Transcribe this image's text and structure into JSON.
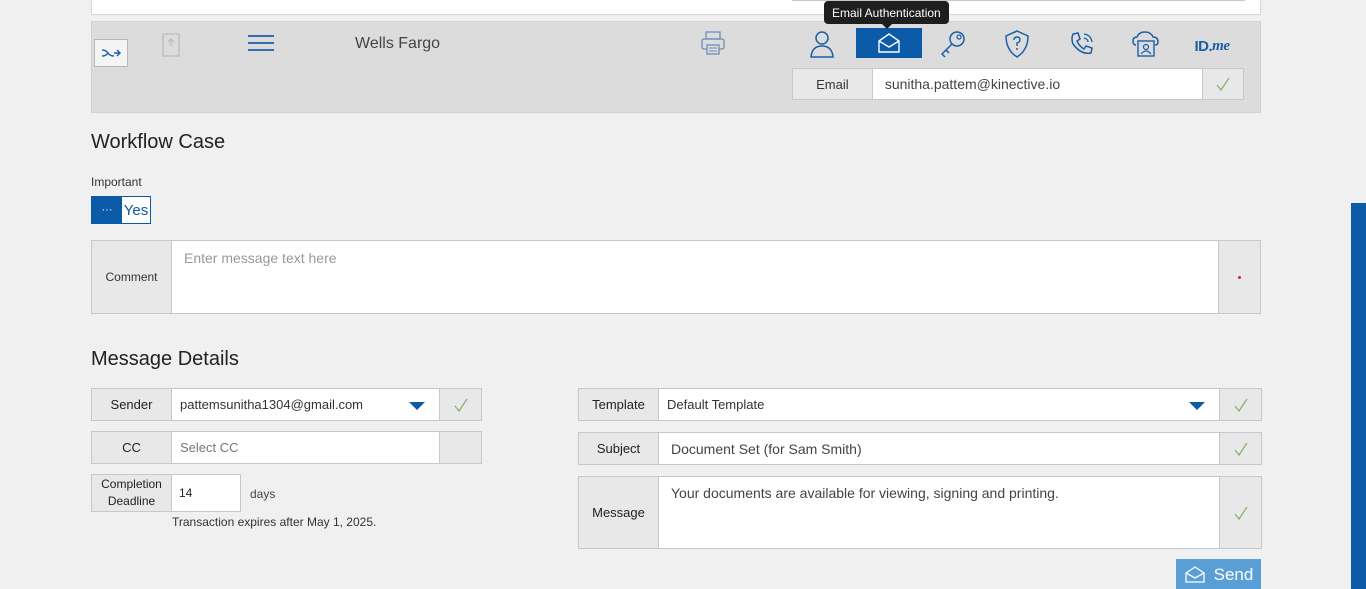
{
  "toolbar": {
    "org_name": "Wells Fargo",
    "tooltip": "Email Authentication",
    "idme_label_main": "ID.",
    "idme_label_suffix": "me",
    "email_label": "Email",
    "email_value": "sunitha.pattem@kinective.io",
    "active_color": "#0b5ba8"
  },
  "workflow": {
    "title": "Workflow Case",
    "important_label": "Important",
    "important_knob": "···",
    "important_value": "Yes",
    "comment_label": "Comment",
    "comment_placeholder": "Enter message text here"
  },
  "message": {
    "title": "Message Details",
    "sender_label": "Sender",
    "sender_value": "pattemsunitha1304@gmail.com",
    "cc_label": "CC",
    "cc_placeholder": "Select CC",
    "deadline_label": "Completion Deadline",
    "deadline_value": "14",
    "deadline_unit": "days",
    "expiry_note": "Transaction expires after May 1, 2025.",
    "template_label": "Template",
    "template_value": "Default Template",
    "subject_label": "Subject",
    "subject_value": "Document Set (for Sam Smith)",
    "message_label": "Message",
    "message_value": "Your documents are available for viewing, signing and printing.",
    "send_label": "Send"
  },
  "icons": [
    "exit-icon",
    "document-icon",
    "hamburger-menu-icon",
    "printer-icon",
    "person-icon",
    "envelope-icon",
    "key-icon",
    "shield-question-icon",
    "phone-icon",
    "cloud-person-icon",
    "check-icon"
  ]
}
